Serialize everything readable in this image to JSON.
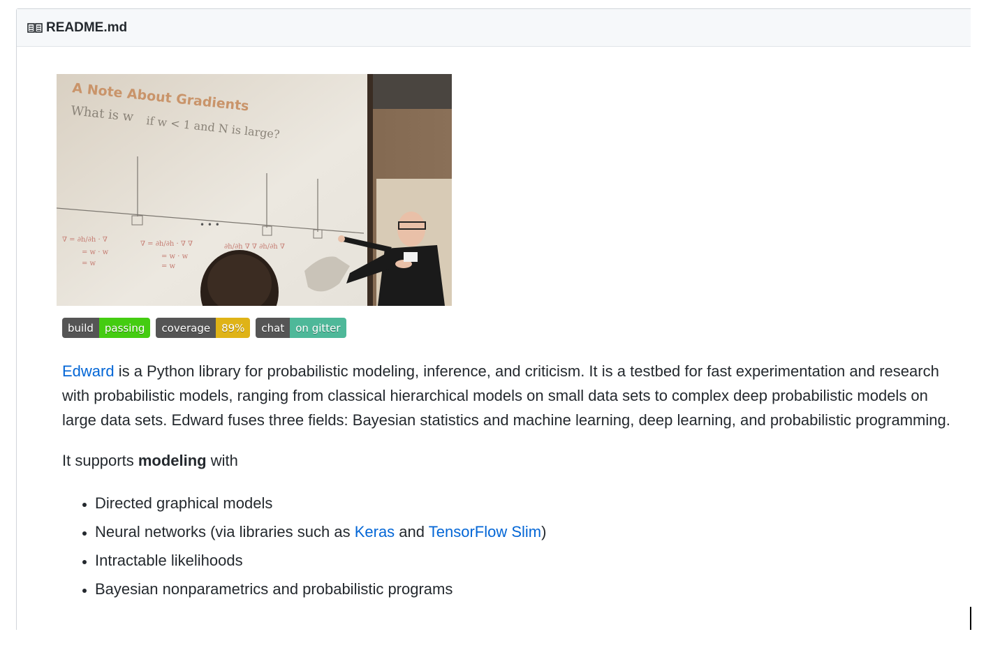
{
  "readme": {
    "title": "README.md",
    "icon": "book-icon"
  },
  "image": {
    "alt": "lecture photo",
    "slide_title": "A Note About Gradients",
    "slide_question": "What is w_h^N if w_h < 1 and N is large?"
  },
  "badges": [
    {
      "label": "build",
      "value": "passing",
      "color": "#4c1"
    },
    {
      "label": "coverage",
      "value": "89%",
      "color": "#dfb317"
    },
    {
      "label": "chat",
      "value": "on gitter",
      "color": "#4eb899"
    }
  ],
  "intro": {
    "link": "Edward",
    "text": " is a Python library for probabilistic modeling, inference, and criticism. It is a testbed for fast experimentation and research with probabilistic models, ranging from classical hierarchical models on small data sets to complex deep probabilistic models on large data sets. Edward fuses three fields: Bayesian statistics and machine learning, deep learning, and probabilistic programming."
  },
  "supports": {
    "prefix": "It supports ",
    "bold": "modeling",
    "suffix": " with"
  },
  "list": {
    "item1": "Directed graphical models",
    "item2_prefix": "Neural networks (via libraries such as ",
    "item2_link1": "Keras",
    "item2_mid": " and ",
    "item2_link2": "TensorFlow Slim",
    "item2_suffix": ")",
    "item3": "Intractable likelihoods",
    "item4": "Bayesian nonparametrics and probabilistic programs"
  }
}
